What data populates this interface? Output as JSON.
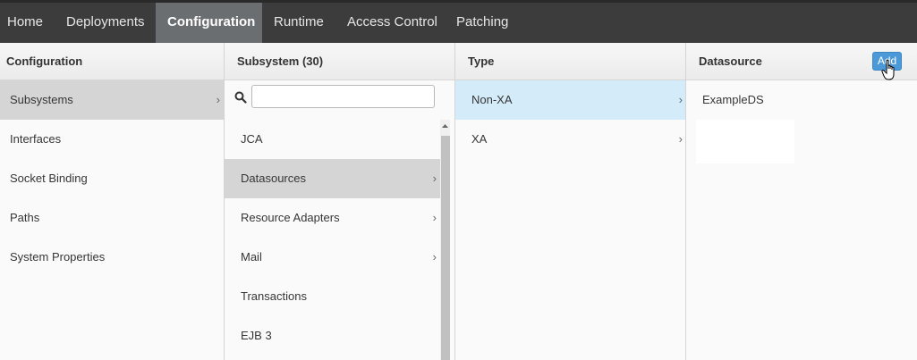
{
  "nav": {
    "items": [
      {
        "label": "Home"
      },
      {
        "label": "Deployments"
      },
      {
        "label": "Configuration",
        "active": true
      },
      {
        "label": "Runtime"
      },
      {
        "label": "Access Control"
      },
      {
        "label": "Patching"
      }
    ]
  },
  "columns": {
    "configuration": {
      "title": "Configuration",
      "items": [
        {
          "label": "Subsystems",
          "selected": true,
          "chevron": "›"
        },
        {
          "label": "Interfaces"
        },
        {
          "label": "Socket Binding"
        },
        {
          "label": "Paths"
        },
        {
          "label": "System Properties"
        }
      ]
    },
    "subsystem": {
      "title": "Subsystem (30)",
      "search": {
        "value": "",
        "placeholder": ""
      },
      "items": [
        {
          "label": "JCA"
        },
        {
          "label": "Datasources",
          "selected": true,
          "chevron": "›"
        },
        {
          "label": "Resource Adapters",
          "chevron": "›"
        },
        {
          "label": "Mail",
          "chevron": "›"
        },
        {
          "label": "Transactions"
        },
        {
          "label": "EJB 3"
        }
      ]
    },
    "type": {
      "title": "Type",
      "items": [
        {
          "label": "Non-XA",
          "selected": true,
          "chevron": "›"
        },
        {
          "label": "XA",
          "chevron": "›"
        }
      ]
    },
    "datasource": {
      "title": "Datasource",
      "add_label": "Add",
      "items": [
        {
          "label": "ExampleDS"
        }
      ]
    }
  },
  "icons": {
    "search": "search-icon",
    "cursor": "hand-pointer-icon",
    "scroll_up": "chevron-up-icon"
  },
  "colors": {
    "topbar": "#3c3c3c",
    "nav_active": "#6a6e71",
    "selected_gray": "#d5d5d5",
    "selected_blue": "#d4ebf9",
    "add_button": "#4c99d8"
  }
}
